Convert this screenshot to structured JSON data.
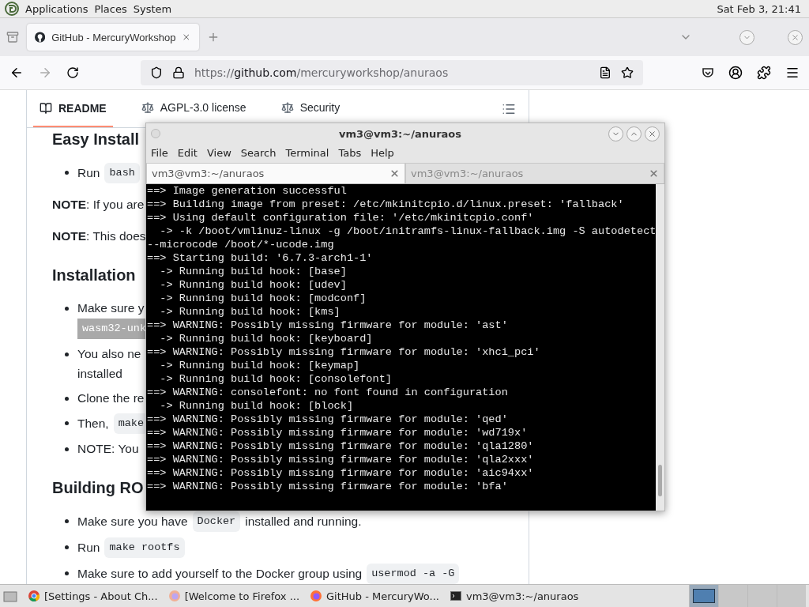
{
  "top_panel": {
    "menus": [
      "Applications",
      "Places",
      "System"
    ],
    "clock": "Sat Feb 3, 21:41"
  },
  "browser": {
    "tabs": [
      {
        "title": "GitHub - MercuryWorkshop",
        "selected": true
      }
    ],
    "url": {
      "scheme": "https://",
      "host": "github.com",
      "path": "/mercuryworkshop/anuraos"
    },
    "forward_disabled": true
  },
  "readme_nav": [
    {
      "label": "README",
      "selected": true,
      "kind": "book"
    },
    {
      "label": "AGPL-3.0 license",
      "selected": false,
      "kind": "scale"
    },
    {
      "label": "Security",
      "selected": false,
      "kind": "scale"
    }
  ],
  "content": [
    {
      "kind": "heading",
      "text": "Easy Install"
    },
    {
      "kind": "bullet",
      "lines": [
        [
          {
            "kind": "text",
            "text": "Run"
          },
          {
            "kind": "code",
            "text": "bash"
          }
        ]
      ]
    },
    {
      "kind": "para",
      "text": "**NOTE**: If you are"
    },
    {
      "kind": "para",
      "text": "**NOTE**: This does"
    },
    {
      "kind": "heading",
      "text": "Installation"
    },
    {
      "kind": "bullet",
      "lines": [
        [
          {
            "kind": "text",
            "text": "Make sure y"
          }
        ],
        [
          {
            "kind": "code",
            "text": "wasm32-unk",
            "highlighted": true
          }
        ]
      ]
    },
    {
      "kind": "bullet",
      "lines": [
        [
          {
            "kind": "text",
            "text": "You also ne"
          }
        ],
        [
          {
            "kind": "text",
            "text": "installed"
          }
        ]
      ]
    },
    {
      "kind": "bullet",
      "lines": [
        [
          {
            "kind": "text",
            "text": "Clone the re"
          }
        ]
      ]
    },
    {
      "kind": "bullet",
      "lines": [
        [
          {
            "kind": "text",
            "text": "Then,"
          },
          {
            "kind": "code",
            "text": "make"
          }
        ]
      ]
    },
    {
      "kind": "bullet",
      "lines": [
        [
          {
            "kind": "text",
            "text": "NOTE: You"
          }
        ]
      ]
    },
    {
      "kind": "heading",
      "text": "Building RO"
    },
    {
      "kind": "bullet",
      "lines": [
        [
          {
            "kind": "text",
            "text": "Make sure you have"
          },
          {
            "kind": "code",
            "text": "Docker"
          },
          {
            "kind": "text",
            "text": "installed and running."
          }
        ]
      ]
    },
    {
      "kind": "bullet",
      "lines": [
        [
          {
            "kind": "text",
            "text": "Run"
          },
          {
            "kind": "code",
            "text": "make rootfs"
          }
        ]
      ]
    },
    {
      "kind": "bullet",
      "lines": [
        [
          {
            "kind": "text",
            "text": "Make sure to add yourself to the Docker group using"
          },
          {
            "kind": "code",
            "text": "usermod -a -G"
          }
        ]
      ]
    }
  ],
  "terminal": {
    "title": "vm3@vm3:~/anuraos",
    "menus": [
      "File",
      "Edit",
      "View",
      "Search",
      "Terminal",
      "Tabs",
      "Help"
    ],
    "tabs": [
      {
        "title": "vm3@vm3:~/anuraos",
        "selected": true
      },
      {
        "title": "vm3@vm3:~/anuraos",
        "selected": false
      }
    ],
    "lines": [
      "==> Image generation successful",
      "==> Building image from preset: /etc/mkinitcpio.d/linux.preset: 'fallback'",
      "==> Using default configuration file: '/etc/mkinitcpio.conf'",
      "  -> -k /boot/vmlinuz-linux -g /boot/initramfs-linux-fallback.img -S autodetect",
      "--microcode /boot/*-ucode.img",
      "==> Starting build: '6.7.3-arch1-1'",
      "  -> Running build hook: [base]",
      "  -> Running build hook: [udev]",
      "  -> Running build hook: [modconf]",
      "  -> Running build hook: [kms]",
      "==> WARNING: Possibly missing firmware for module: 'ast'",
      "  -> Running build hook: [keyboard]",
      "==> WARNING: Possibly missing firmware for module: 'xhci_pci'",
      "  -> Running build hook: [keymap]",
      "  -> Running build hook: [consolefont]",
      "==> WARNING: consolefont: no font found in configuration",
      "  -> Running build hook: [block]",
      "==> WARNING: Possibly missing firmware for module: 'qed'",
      "==> WARNING: Possibly missing firmware for module: 'wd719x'",
      "==> WARNING: Possibly missing firmware for module: 'qla1280'",
      "==> WARNING: Possibly missing firmware for module: 'qla2xxx'",
      "==> WARNING: Possibly missing firmware for module: 'aic94xx'",
      "==> WARNING: Possibly missing firmware for module: 'bfa'"
    ]
  },
  "taskbar": {
    "tasks": [
      {
        "title": "[Settings - About Ch...",
        "kind": "chrome"
      },
      {
        "title": "[Welcome to Firefox ...",
        "kind": "firefox-faded"
      },
      {
        "title": "GitHub - MercuryWo...",
        "kind": "firefox"
      },
      {
        "title": "vm3@vm3:~/anuraos",
        "kind": "terminal"
      }
    ],
    "workspaces": [
      {
        "selected": true
      },
      {
        "selected": false
      },
      {
        "selected": false
      },
      {
        "selected": false
      }
    ]
  }
}
